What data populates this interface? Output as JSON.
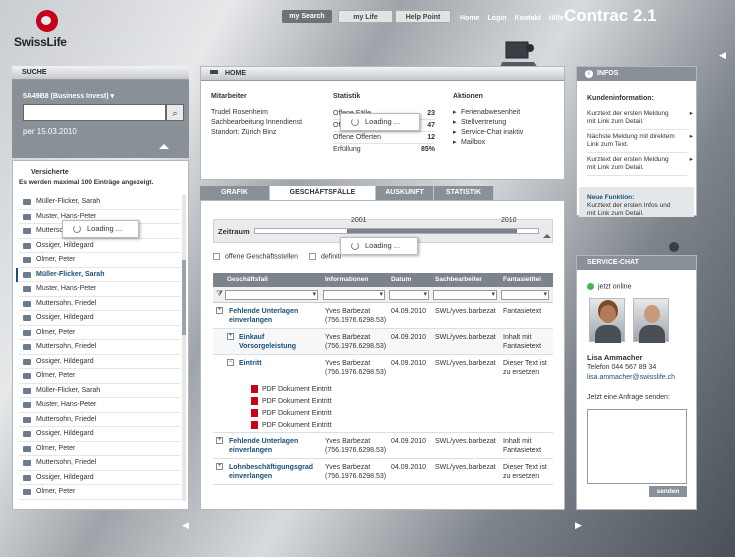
{
  "brand": {
    "logo_text": "SwissLife",
    "app_title": "Contrac 2.1"
  },
  "topnav": {
    "tabs": [
      "my Search",
      "my Life",
      "Help Point"
    ],
    "links": [
      "Home",
      "Login",
      "Kontakt",
      "Hilfe"
    ]
  },
  "suche": {
    "title": "SUCHE",
    "contract": "5A49B8 (Business Invest)",
    "date": "per 15.03.2010",
    "versicherte_title": "Versicherte",
    "hint": "Es werden maximal 100 Einträge angezeigt.",
    "loading": "Loading ...",
    "items": [
      "Müller-Flicker, Sarah",
      "Muster, Hans-Peter",
      "Muttersohn, Friedel",
      "Ossiger, Hildegard",
      "Olmer, Peter",
      "Müller-Flicker, Sarah",
      "Muster, Hans-Peter",
      "Muttersohn, Friedel",
      "Ossiger, Hildegard",
      "Olmer, Peter",
      "Muttersohn, Friedel",
      "Ossiger, Hildegard",
      "Olmer, Peter",
      "Müller-Flicker, Sarah",
      "Muster, Hans-Peter",
      "Muttersohn, Friedel",
      "Ossiger, Hildegard",
      "Olmer, Peter",
      "Muttersohn, Friedel",
      "Ossiger, Hildegard",
      "Olmer, Peter"
    ]
  },
  "home": {
    "title": "HOME",
    "mitarbeiter": {
      "title": "Mitarbeiter",
      "lines": [
        "Trudel Rosenheim",
        "Sachbearbeitung Innendienst",
        "Standort: Zürich Binz"
      ]
    },
    "statistik": {
      "title": "Statistik",
      "rows": [
        {
          "label": "Offene Fälle",
          "value": "23"
        },
        {
          "label": "Offene",
          "value": "47"
        },
        {
          "label": "Offene Offerten",
          "value": "12"
        },
        {
          "label": "Erfüllung",
          "value": "85%"
        }
      ]
    },
    "aktionen": {
      "title": "Aktionen",
      "items": [
        "Ferienabwesenheit",
        "Stellvertretung",
        "Service-Chat inaktiv",
        "Mailbox"
      ]
    },
    "loading": "Loading ..."
  },
  "tabs": [
    "GRAFIK",
    "GESCHÄFTSFÄLLE",
    "AUSKUNFT",
    "STATISTIK"
  ],
  "main": {
    "zeitraum_label": "Zeitraum",
    "year_start": "2001",
    "year_end": "2010",
    "loading": "Loading ...",
    "check1": "offene Geschäftsstellen",
    "check2": "definiti",
    "columns": [
      "Geschäftsfall",
      "Informationen",
      "Datum",
      "Sachbearbeiter",
      "Fantasietitel"
    ],
    "rows": [
      {
        "fall": [
          "Fehlende Unterlagen",
          "einverlangen"
        ],
        "info": [
          "Yves Barbezat",
          "(756.1976.6298.53)"
        ],
        "datum": "04.09.2010",
        "sb": "SWL/yves.barbezat",
        "fan": [
          "Fantasietext"
        ]
      },
      {
        "fall": [
          "Einkauf",
          "Vorsorgeleistung"
        ],
        "info": [
          "Yves Barbezat",
          "(756.1976.6298.53)"
        ],
        "datum": "04.09.2010",
        "sb": "SWL/yves.barbezat",
        "fan": [
          "Inhalt mit",
          "Fantasietext"
        ]
      },
      {
        "fall": [
          "Eintritt"
        ],
        "info": [
          "Yves Barbezat",
          "(756.1976.6298.53)"
        ],
        "datum": "04.09.2010",
        "sb": "SWL/yves.barbezat",
        "fan": [
          "Dieser Text ist",
          "zu ersetzen"
        ]
      },
      {
        "fall": [
          "Fehlende Unterlagen",
          "einverlangen"
        ],
        "info": [
          "Yves Barbezat",
          "(756.1976.6298.53)"
        ],
        "datum": "04.09.2010",
        "sb": "SWL/yves.barbezat",
        "fan": [
          "Inhalt mit",
          "Fantasietext"
        ]
      },
      {
        "fall": [
          "Lohnbeschäftigungsgrad",
          "einverlangen"
        ],
        "info": [
          "Yves Barbezat",
          "(756.1976.6298.53)"
        ],
        "datum": "04.09.2010",
        "sb": "SWL/yves.barbezat",
        "fan": [
          "Dieser Text ist",
          "zu ersetzen"
        ]
      }
    ],
    "pdfs": [
      "PDF Dokument Eintritt",
      "PDF Dokument Eintritt",
      "PDF Dokument Eintritt",
      "PDF Dokument Eintritt"
    ]
  },
  "infos": {
    "title": "INFOS",
    "kunden_title": "Kundeninformation:",
    "items": [
      [
        "Kurztext der ersten Meldung",
        "mit Link zum Detail."
      ],
      [
        "Nächste Meldung mit direktem",
        "Link zum Text."
      ],
      [
        "Kurztext der ersten Meldung",
        "mit Link zum Detail."
      ]
    ],
    "neue_title": "Neue Funktion:",
    "neue_lines": [
      "Kurztext der ersten Infos und",
      "mit Link zum Detail."
    ]
  },
  "chat": {
    "title": "SERVICE-CHAT",
    "status": "jetzt online",
    "name": "Lisa Ammacher",
    "tel": "Telefon 044 567 89 34",
    "mail": "lisa.ammacher@swisslife.ch",
    "ask": "Jetzt eine Anfrage senden:",
    "send": "senden"
  },
  "colors": {
    "brand_red": "#c4001a",
    "link_blue": "#1b4f78",
    "panel_grey": "#8a9097"
  }
}
